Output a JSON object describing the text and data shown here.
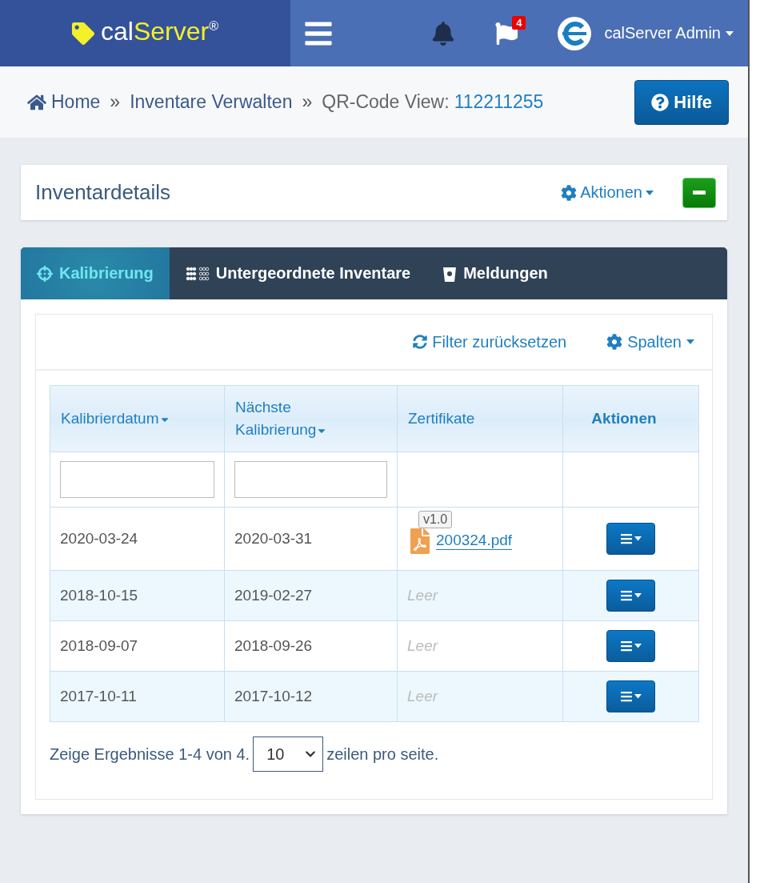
{
  "header": {
    "logo": {
      "part_1": "cal",
      "part_2": "Server",
      "mark": "®"
    },
    "notification_count": "4",
    "user": "calServer Admin"
  },
  "breadcrumb": {
    "items": [
      {
        "label": "Home",
        "kind": "home"
      },
      {
        "label": "Inventare Verwalten",
        "kind": "link"
      }
    ],
    "separator": "»",
    "current_label": "QR-Code View:",
    "current_value": "112211255"
  },
  "help_button": "Hilfe",
  "card": {
    "title": "Inventardetails",
    "actions": "Aktionen"
  },
  "tabs": [
    {
      "label": "Kalibrierung",
      "kind": "crosshair",
      "selected": true
    },
    {
      "label": "Untergeordnete Inventare",
      "kind": "grid",
      "selected": false
    },
    {
      "label": "Meldungen",
      "kind": "bucket",
      "selected": false
    }
  ],
  "toolbar": {
    "reset": "Filter zurücksetzen",
    "columns": "Spalten"
  },
  "table": {
    "columns": [
      {
        "label": "Kalibrierdatum",
        "sortable": true,
        "filter": true
      },
      {
        "label": "Nächste Kalibrierung",
        "sortable": true,
        "filter": true
      },
      {
        "label": "Zertifikate",
        "sortable": false,
        "filter": false
      },
      {
        "label": "Aktionen",
        "sortable": false,
        "filter": false
      }
    ],
    "rows": [
      {
        "date": "2020-03-24",
        "next": "2020-03-31",
        "certificate": {
          "file": "200324.pdf",
          "version": "v1.0"
        }
      },
      {
        "date": "2018-10-15",
        "next": "2019-02-27",
        "empty": "Leer"
      },
      {
        "date": "2018-09-07",
        "next": "2018-09-26",
        "empty": "Leer"
      },
      {
        "date": "2017-10-11",
        "next": "2017-10-12",
        "empty": "Leer"
      }
    ]
  },
  "pagination": {
    "text_before": "Zeige Ergebnisse 1-4 von 4.",
    "page_size": "10",
    "text_after": "zeilen pro seite."
  }
}
